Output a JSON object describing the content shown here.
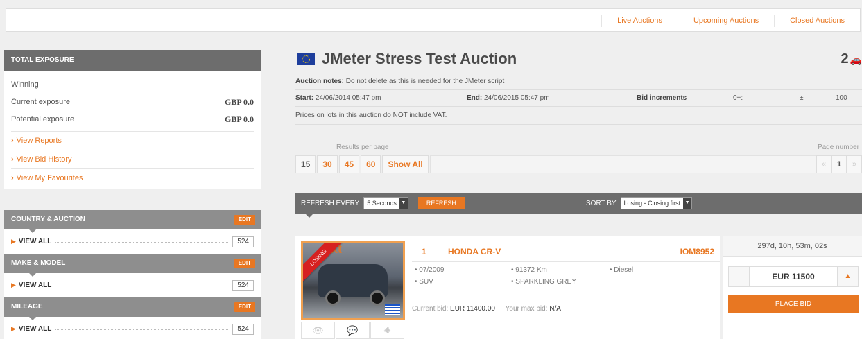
{
  "nav": {
    "links": [
      "Live Auctions",
      "Upcoming Auctions",
      "Closed Auctions"
    ]
  },
  "exposure": {
    "title": "TOTAL EXPOSURE",
    "winning_label": "Winning",
    "current_label": "Current exposure",
    "current_value": "GBP 0.0",
    "potential_label": "Potential exposure",
    "potential_value": "GBP 0.0",
    "links": [
      "View Reports",
      "View Bid History",
      "View My Favourites"
    ]
  },
  "filters": [
    {
      "title": "COUNTRY & AUCTION",
      "edit": "EDIT",
      "item": "VIEW ALL",
      "count": "524"
    },
    {
      "title": "MAKE & MODEL",
      "edit": "EDIT",
      "item": "VIEW ALL",
      "count": "524"
    },
    {
      "title": "MILEAGE",
      "edit": "EDIT",
      "item": "VIEW ALL",
      "count": "524"
    }
  ],
  "auction": {
    "title": "JMeter Stress Test Auction",
    "lot_count": "2",
    "notes_label": "Auction notes:",
    "notes": "Do not delete as this is needed for the JMeter script",
    "start_label": "Start:",
    "start": "24/06/2014 05:47 pm",
    "end_label": "End:",
    "end": "24/06/2015 05:47 pm",
    "bid_increments_label": "Bid increments",
    "increment_from": "0+:",
    "increment_sign": "±",
    "increment_value": "100",
    "vat_note": "Prices on lots in this auction do NOT include VAT."
  },
  "pagination": {
    "results_label": "Results per page",
    "options": [
      "15",
      "30",
      "45",
      "60",
      "Show All"
    ],
    "active": "15",
    "page_label": "Page number",
    "prev": "«",
    "current": "1",
    "next": "»"
  },
  "toolbar": {
    "refresh_label": "REFRESH EVERY",
    "refresh_value": "5 Seconds",
    "refresh_button": "REFRESH",
    "sort_label": "SORT BY",
    "sort_value": "Losing - Closing first"
  },
  "lot": {
    "status": "LOSING",
    "number": "1",
    "model": "HONDA CR-V",
    "ref": "IOM8952",
    "date": "• 07/2009",
    "mileage": "• 91372 Km",
    "fuel": "• Diesel",
    "body": "• SUV",
    "colour": "• SPARKLING GREY",
    "current_bid_label": "Current bid:",
    "current_bid": "EUR 11400.00",
    "max_bid_label": "Your max bid:",
    "max_bid": "N/A",
    "time_left": "297d, 10h, 53m, 02s",
    "bid_amount": "EUR 11500",
    "place_bid": "PLACE BID",
    "image_sign": "ext"
  },
  "colors": {
    "accent": "#e87722",
    "panel": "#6d6d6d",
    "losing": "#d62020"
  }
}
